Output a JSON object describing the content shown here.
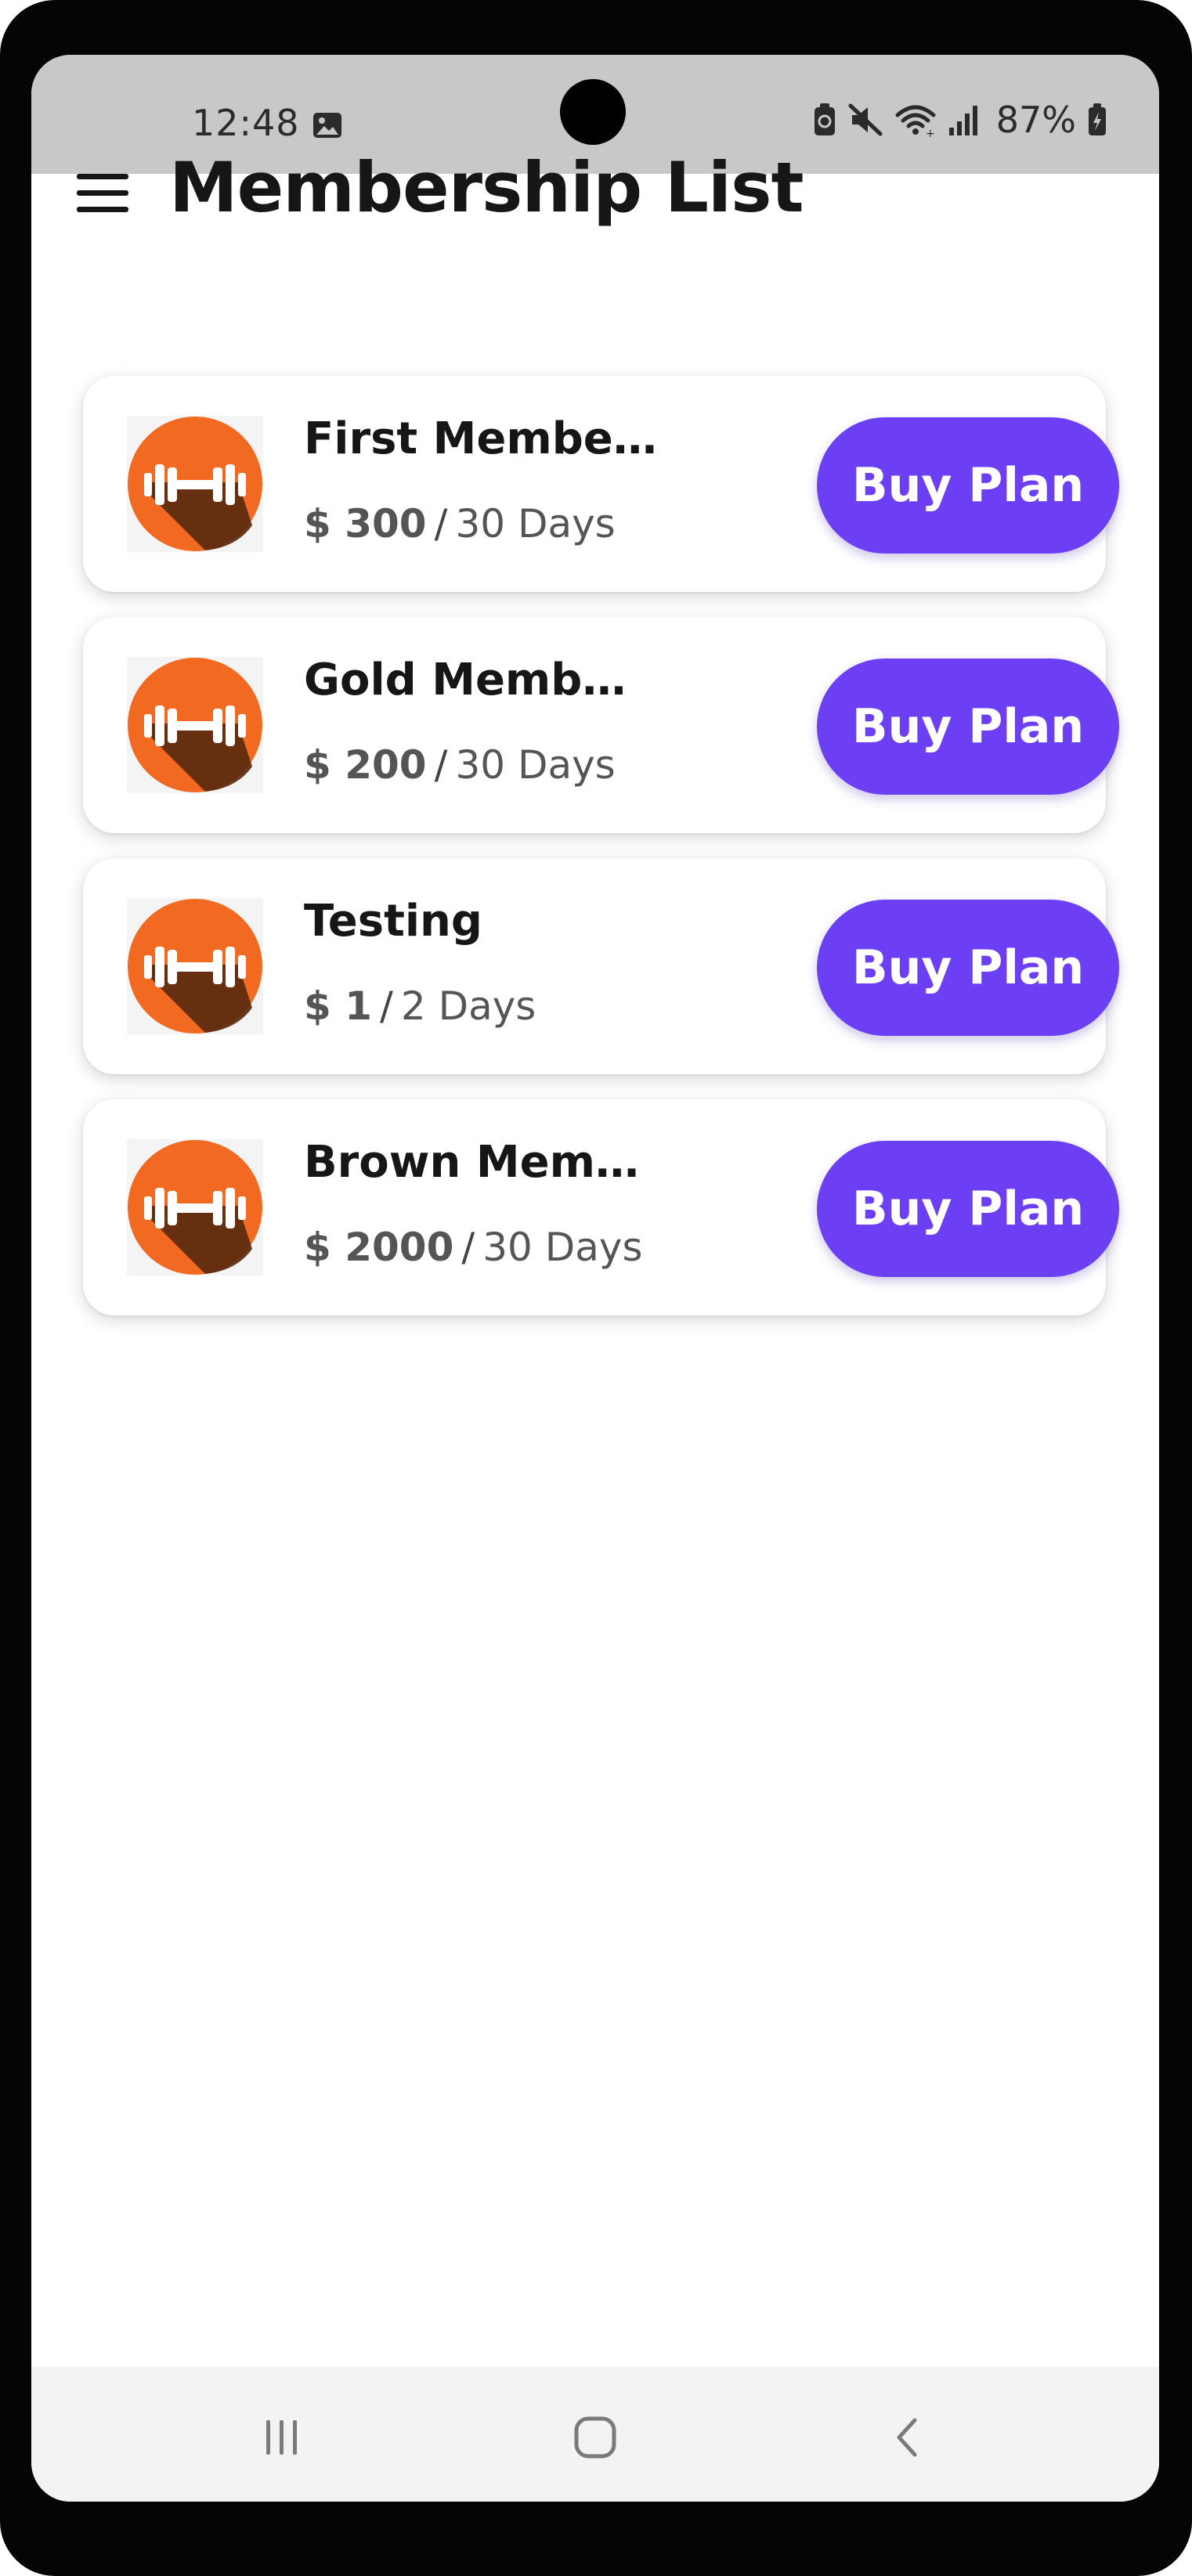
{
  "status_bar": {
    "time": "12:48",
    "battery": "87%",
    "icons": [
      "gallery-icon",
      "battery-saver-icon",
      "mute-icon",
      "wifi-icon",
      "signal-icon",
      "battery-charging-icon"
    ]
  },
  "app_bar": {
    "title": "Membership List",
    "menu_icon": "hamburger-menu-icon"
  },
  "plans": [
    {
      "name": "First Membe…",
      "price": "$ 300",
      "separator": "/",
      "duration": "30 Days",
      "button_label": "Buy Plan"
    },
    {
      "name": "Gold Memb…",
      "price": "$ 200",
      "separator": "/",
      "duration": "30 Days",
      "button_label": "Buy Plan"
    },
    {
      "name": "Testing",
      "price": "$ 1",
      "separator": "/",
      "duration": "2 Days",
      "button_label": "Buy Plan"
    },
    {
      "name": "Brown Mem…",
      "price": "$ 2000",
      "separator": "/",
      "duration": "30 Days",
      "button_label": "Buy Plan"
    }
  ],
  "nav_bar": {
    "buttons": [
      "recent-apps-icon",
      "home-icon",
      "back-icon"
    ]
  },
  "colors": {
    "accent": "#6c3ff5",
    "logo_orange": "#f26a21",
    "logo_shadow": "#5a2a0e",
    "status_bar_bg": "#c8c8c8",
    "nav_bar_bg": "#f3f3f3"
  }
}
